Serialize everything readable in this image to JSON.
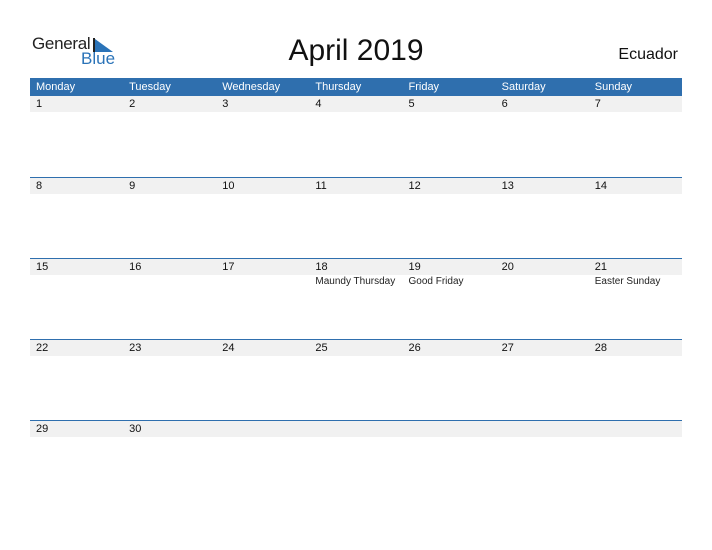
{
  "logo": {
    "line1": "General",
    "line2": "Blue"
  },
  "title": "April 2019",
  "country": "Ecuador",
  "colors": {
    "accent": "#2f6fae",
    "strip": "#f1f1f1"
  },
  "weekdays": [
    "Monday",
    "Tuesday",
    "Wednesday",
    "Thursday",
    "Friday",
    "Saturday",
    "Sunday"
  ],
  "weeks": [
    {
      "days": [
        "1",
        "2",
        "3",
        "4",
        "5",
        "6",
        "7"
      ],
      "events": [
        "",
        "",
        "",
        "",
        "",
        "",
        ""
      ]
    },
    {
      "days": [
        "8",
        "9",
        "10",
        "11",
        "12",
        "13",
        "14"
      ],
      "events": [
        "",
        "",
        "",
        "",
        "",
        "",
        ""
      ]
    },
    {
      "days": [
        "15",
        "16",
        "17",
        "18",
        "19",
        "20",
        "21"
      ],
      "events": [
        "",
        "",
        "",
        "Maundy Thursday",
        "Good Friday",
        "",
        "Easter Sunday"
      ]
    },
    {
      "days": [
        "22",
        "23",
        "24",
        "25",
        "26",
        "27",
        "28"
      ],
      "events": [
        "",
        "",
        "",
        "",
        "",
        "",
        ""
      ]
    },
    {
      "days": [
        "29",
        "30",
        "",
        "",
        "",
        "",
        ""
      ],
      "events": [
        "",
        "",
        "",
        "",
        "",
        "",
        ""
      ]
    }
  ]
}
